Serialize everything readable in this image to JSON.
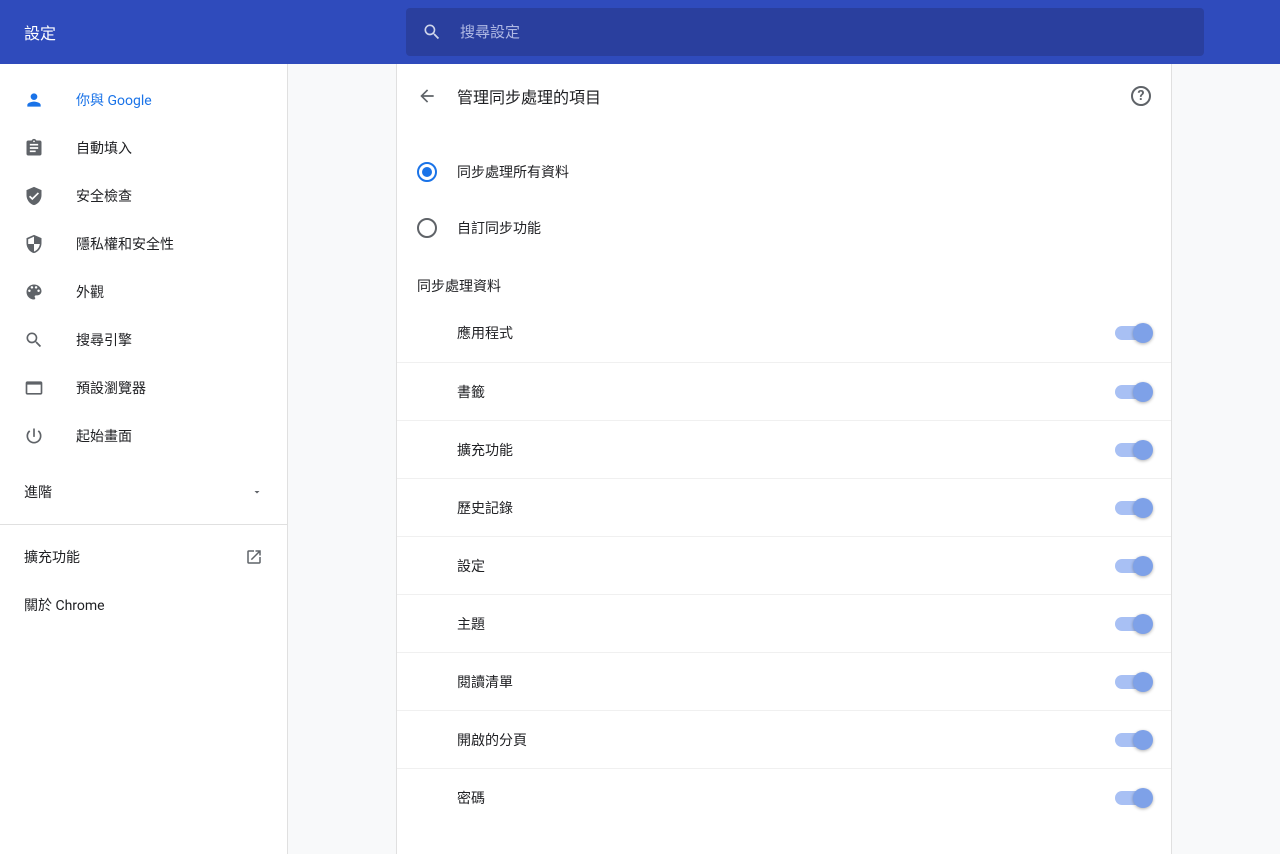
{
  "header": {
    "title": "設定",
    "search_placeholder": "搜尋設定"
  },
  "sidebar": {
    "items": [
      {
        "label": "你與 Google"
      },
      {
        "label": "自動填入"
      },
      {
        "label": "安全檢查"
      },
      {
        "label": "隱私權和安全性"
      },
      {
        "label": "外觀"
      },
      {
        "label": "搜尋引擎"
      },
      {
        "label": "預設瀏覽器"
      },
      {
        "label": "起始畫面"
      }
    ],
    "advanced": "進階",
    "extensions": "擴充功能",
    "about": "關於 Chrome"
  },
  "panel": {
    "title": "管理同步處理的項目",
    "radio": {
      "all": "同步處理所有資料",
      "custom": "自訂同步功能"
    },
    "section": "同步處理資料",
    "toggles": [
      {
        "label": "應用程式"
      },
      {
        "label": "書籤"
      },
      {
        "label": "擴充功能"
      },
      {
        "label": "歷史記錄"
      },
      {
        "label": "設定"
      },
      {
        "label": "主題"
      },
      {
        "label": "閱讀清單"
      },
      {
        "label": "開啟的分頁"
      },
      {
        "label": "密碼"
      }
    ]
  }
}
